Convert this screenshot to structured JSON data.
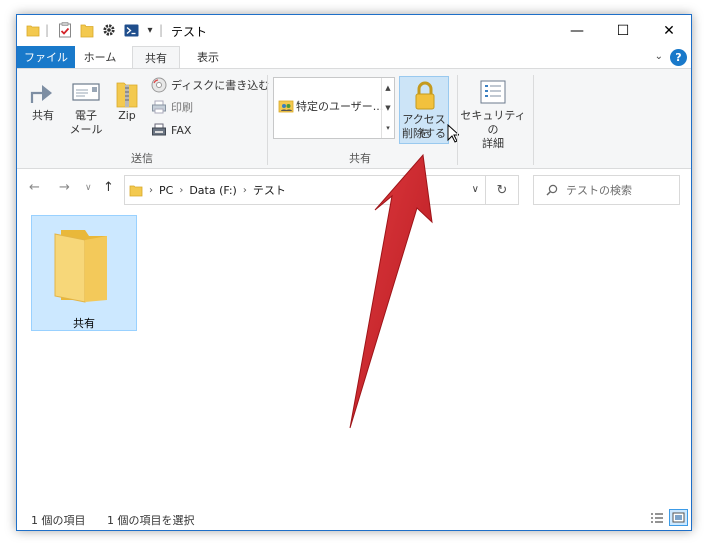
{
  "window": {
    "title": "テスト",
    "controls": {
      "minimize": "—",
      "maximize": "☐",
      "close": "✕"
    }
  },
  "quick_access": {
    "dropdown": "▾"
  },
  "ribbon_tabs": {
    "file": "ファイル",
    "home": "ホーム",
    "share": "共有",
    "view": "表示",
    "help": "?"
  },
  "ribbon": {
    "send_group": {
      "label": "送信",
      "share": "共有",
      "email_line1": "電子",
      "email_line2": "メール",
      "zip": "Zip",
      "burn": "ディスクに書き込む",
      "print": "印刷",
      "fax": "FAX"
    },
    "share_group": {
      "label": "共有",
      "specific_user": "特定のユーザー...",
      "remove_access_line1": "アクセスを",
      "remove_access_line2": "削除する",
      "security_line1": "セキュリティの",
      "security_line2": "詳細"
    }
  },
  "address_bar": {
    "crumbs": [
      "PC",
      "Data (F:)",
      "テスト"
    ],
    "search_placeholder": "テストの検索"
  },
  "content": {
    "items": [
      {
        "name": "共有",
        "type": "folder",
        "selected": true
      }
    ]
  },
  "status_bar": {
    "item_count": "1 個の項目",
    "selected_count": "1 個の項目を選択"
  },
  "colors": {
    "accent": "#1979ca",
    "selection": "#cce8ff",
    "annotation_red": "#d32228",
    "tab_underline": "#e05a5a"
  }
}
